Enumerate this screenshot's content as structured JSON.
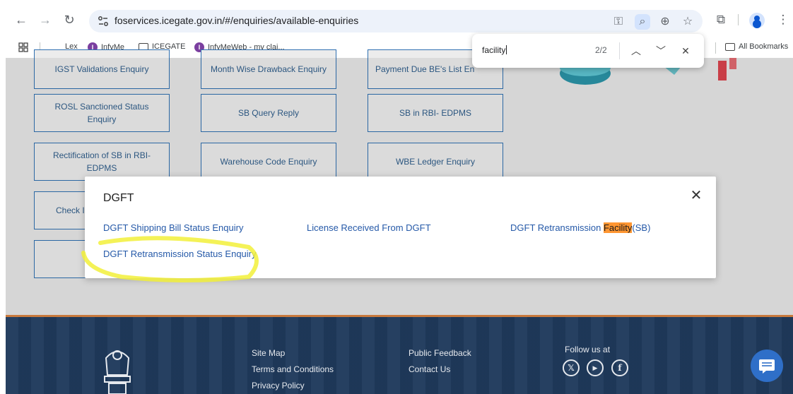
{
  "browser": {
    "url": "foservices.icegate.gov.in/#/enquiries/available-enquiries",
    "bookmarks": [
      {
        "label": "Lex",
        "icon": "none"
      },
      {
        "label": "InfyMe",
        "icon": "infy-logo"
      },
      {
        "label": "ICEGATE",
        "icon": "folder-icon"
      },
      {
        "label": "InfyMeWeb - my clai...",
        "icon": "infy-logo"
      }
    ],
    "all_bookmarks": "All Bookmarks"
  },
  "findbar": {
    "query": "facility",
    "count": "2/2"
  },
  "enquiry_tiles": [
    "IGST Validations Enquiry",
    "Month Wise Drawback Enquiry",
    "Payment Due BE's List En",
    "ROSL Sanctioned Status Enquiry",
    "SB Query Reply",
    "SB in RBI- EDPMS",
    "Rectification of SB in RBI- EDPMS",
    "Warehouse Code Enquiry",
    "WBE Ledger Enquiry",
    "Check IE",
    ""
  ],
  "modal": {
    "title": "DGFT",
    "links": [
      "DGFT Shipping Bill Status Enquiry",
      "License Received From DGFT",
      "DGFT Retransmission ",
      "Facility",
      "(SB)",
      "DGFT Retransmission Status Enquiry"
    ]
  },
  "footer": {
    "links": [
      "Site Map",
      "Terms and Conditions",
      "Privacy Policy",
      "Public Feedback",
      "Contact Us"
    ],
    "follow_label": "Follow us at",
    "social": [
      {
        "icon": "x-icon",
        "glyph": "𝕏"
      },
      {
        "icon": "youtube-icon",
        "glyph": "▶"
      },
      {
        "icon": "facebook-icon",
        "glyph": "f"
      }
    ]
  },
  "colors": {
    "link": "#2559a8",
    "highlight": "#ff9632",
    "marker": "#f2f03a",
    "footer": "#1f3a5c"
  }
}
